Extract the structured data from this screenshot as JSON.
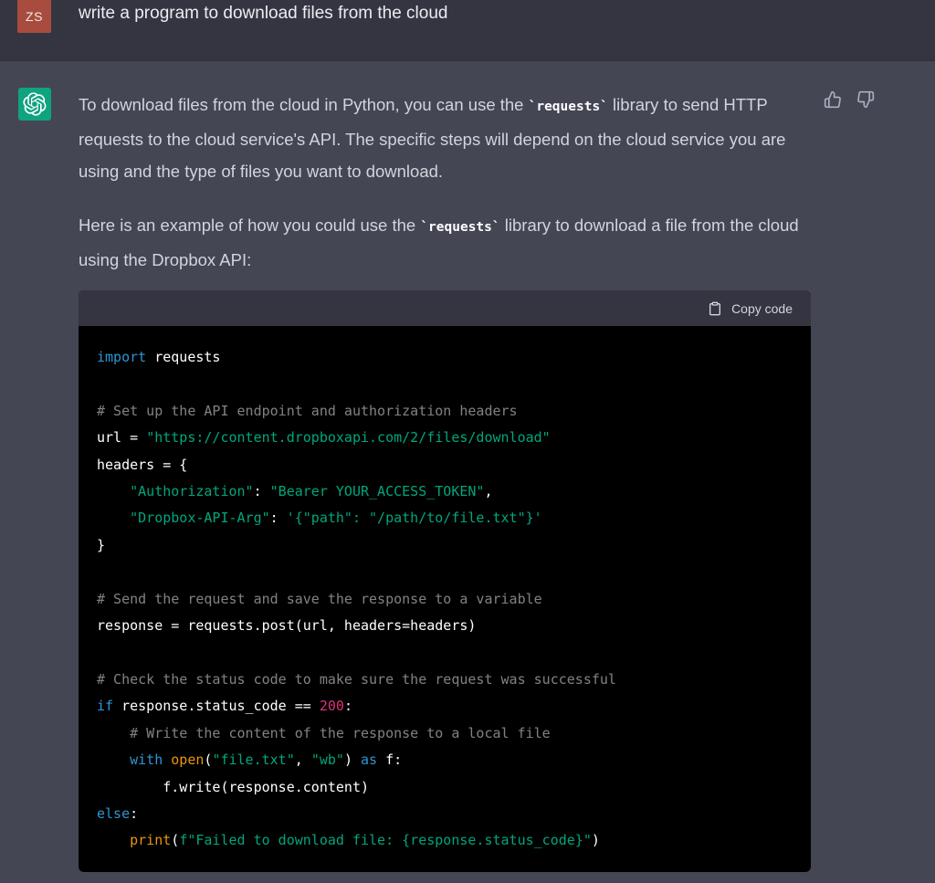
{
  "user": {
    "avatar_initials": "ZS",
    "message": "write a program to download files from the cloud"
  },
  "assistant": {
    "avatar_icon": "openai-logo-icon",
    "paragraph1": {
      "before": "To download files from the cloud in Python, you can use the ",
      "code": "`requests`",
      "after": " library to send HTTP requests to the cloud service's API. The specific steps will depend on the cloud service you are using and the type of files you want to download."
    },
    "paragraph2": {
      "before": "Here is an example of how you could use the ",
      "code": "`requests`",
      "after": " library to download a file from the cloud using the Dropbox API:"
    },
    "feedback": {
      "thumbs_up_icon": "thumbs-up-icon",
      "thumbs_down_icon": "thumbs-down-icon"
    }
  },
  "code_block": {
    "copy_label": "Copy code",
    "copy_icon": "clipboard-icon",
    "language": "python",
    "lines": [
      "import requests",
      "",
      "# Set up the API endpoint and authorization headers",
      "url = \"https://content.dropboxapi.com/2/files/download\"",
      "headers = {",
      "    \"Authorization\": \"Bearer YOUR_ACCESS_TOKEN\",",
      "    \"Dropbox-API-Arg\": '{\"path\": \"/path/to/file.txt\"}'",
      "}",
      "",
      "# Send the request and save the response to a variable",
      "response = requests.post(url, headers=headers)",
      "",
      "# Check the status code to make sure the request was successful",
      "if response.status_code == 200:",
      "    # Write the content of the response to a local file",
      "    with open(\"file.txt\", \"wb\") as f:",
      "        f.write(response.content)",
      "else:",
      "    print(f\"Failed to download file: {response.status_code}\")"
    ]
  },
  "colors": {
    "page_bg": "#444654",
    "user_row_bg": "#343541",
    "user_avatar_bg": "#a84c3f",
    "assistant_avatar_bg": "#10a37f",
    "code_bg": "#000000",
    "keyword": "#2e95d3",
    "string": "#00a67d",
    "number": "#df3079",
    "builtin": "#e9950c"
  }
}
